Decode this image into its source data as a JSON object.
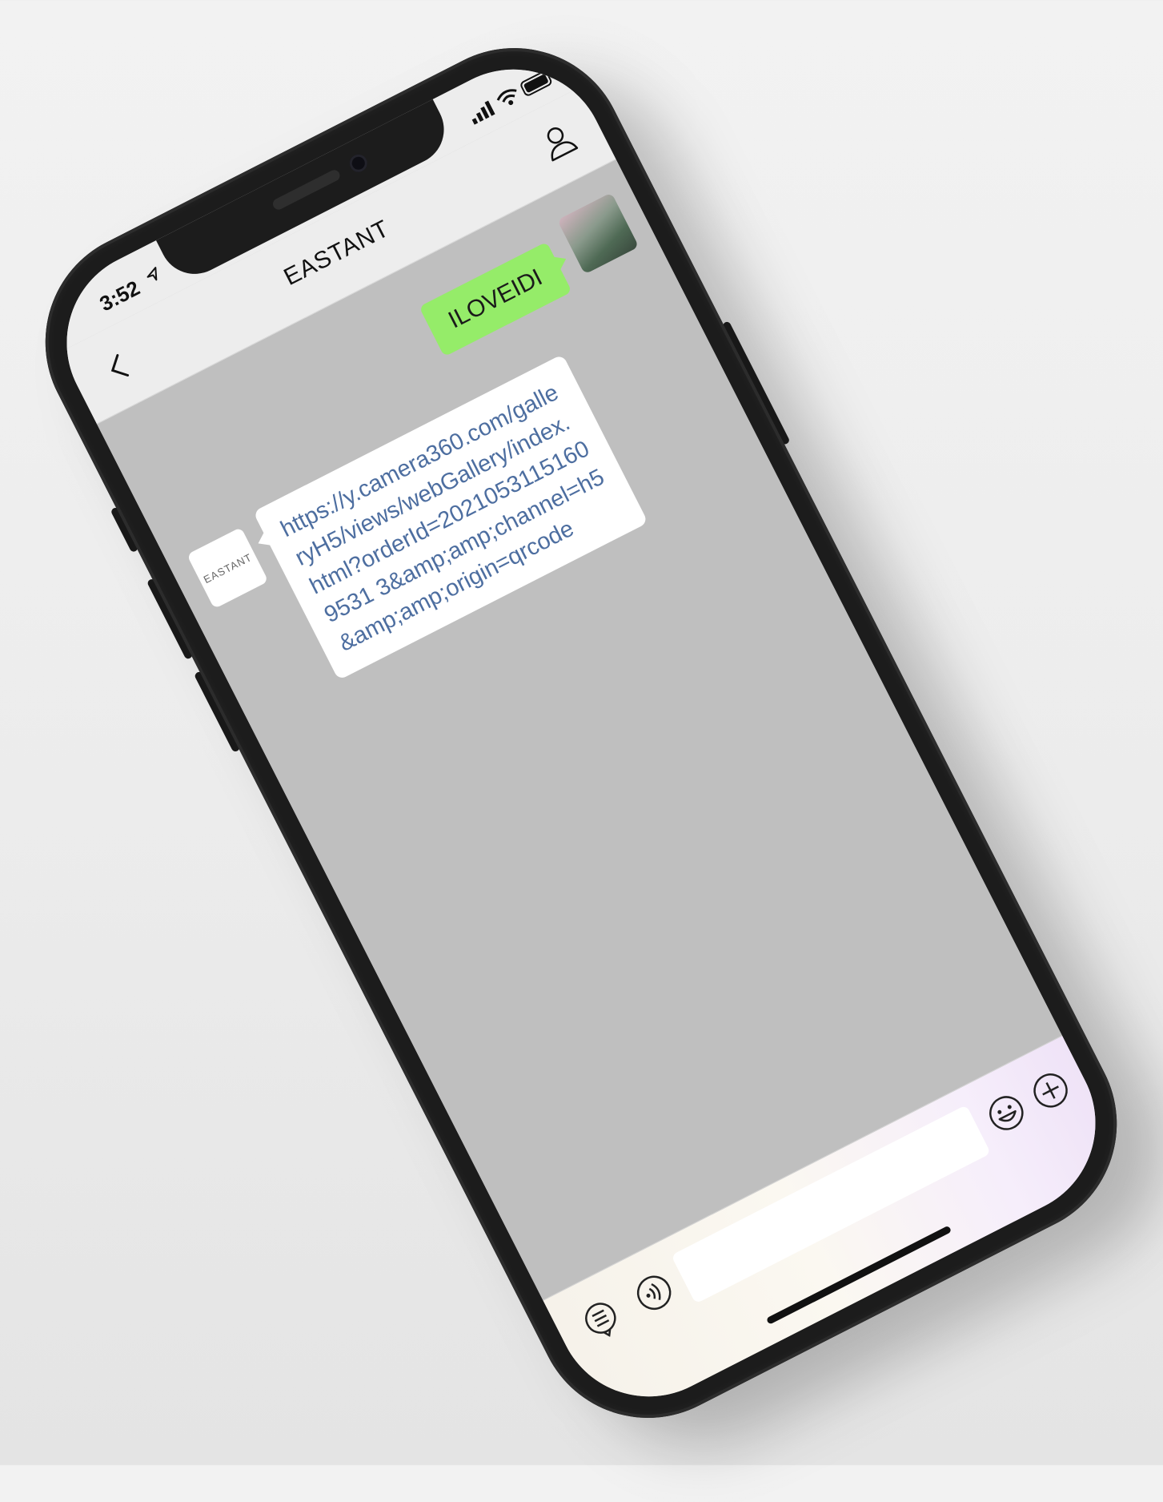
{
  "status_bar": {
    "time": "3:52"
  },
  "nav": {
    "title": "EASTANT"
  },
  "messages": [
    {
      "sender": "me",
      "text": "ILOVEIDI"
    },
    {
      "sender": "them",
      "avatar_logo": "EASTANT",
      "text": "https://y.camera360.com/galleryH5/views/webGallery/index.html?orderId=20210531151609531 3&amp;amp;channel=h5&amp;amp;origin=qrcode"
    }
  ],
  "input_bar": {
    "placeholder": ""
  },
  "icons": {
    "back": "chevron-left-icon",
    "profile": "person-icon",
    "voice": "voice-icon",
    "emoji": "emoji-icon",
    "more": "plus-icon",
    "menu": "list-icon",
    "signal": "signal-icon",
    "wifi": "wifi-icon",
    "battery": "battery-icon",
    "location": "location-arrow-icon"
  },
  "colors": {
    "bubble_me": "#95ec69",
    "bubble_them": "#ffffff",
    "link": "#4d6ea0",
    "chat_bg": "#bfbfbf"
  }
}
